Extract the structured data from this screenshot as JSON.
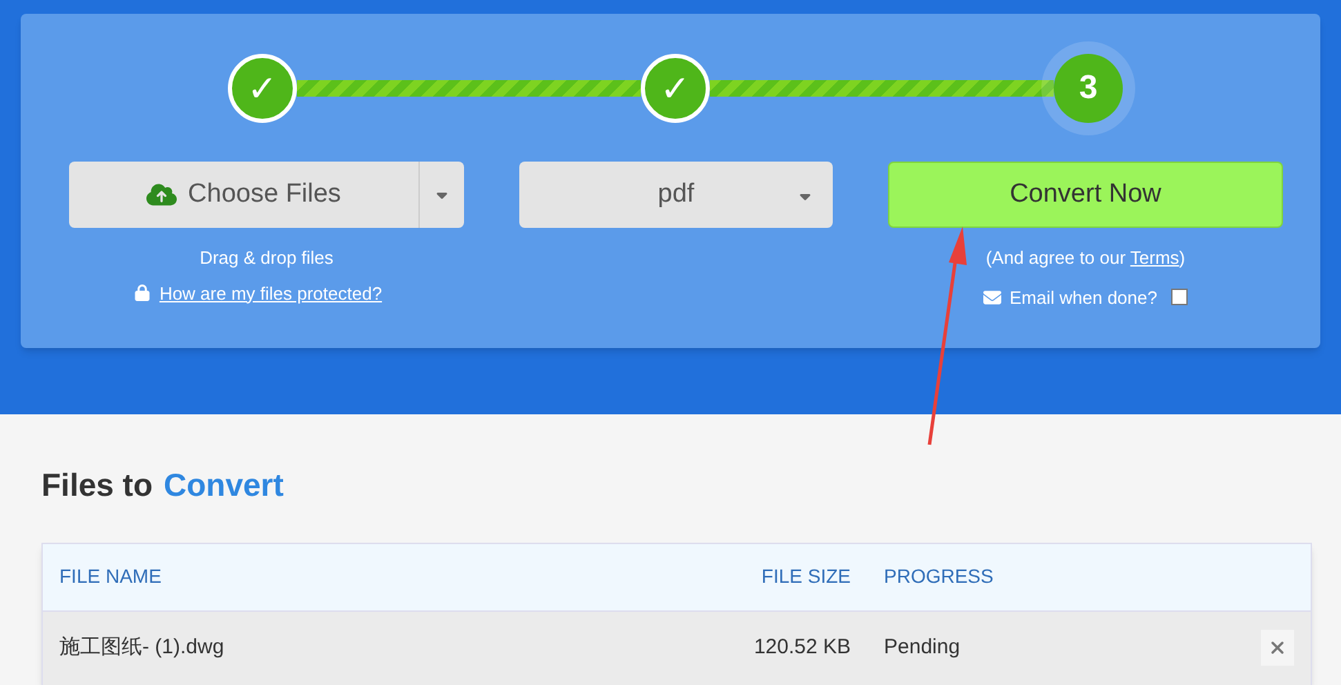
{
  "steps": [
    {
      "label": "✓",
      "kind": "done"
    },
    {
      "label": "✓",
      "kind": "done"
    },
    {
      "label": "3",
      "kind": "current"
    }
  ],
  "connectors": [
    {
      "level": 1
    },
    {
      "level": 1
    }
  ],
  "choose_files": {
    "label": "Choose Files",
    "hint": "Drag & drop files",
    "protect_link": "How are my files protected?"
  },
  "format_select": {
    "value": "pdf"
  },
  "convert": {
    "label": "Convert Now",
    "agree_lead": "(And agree to our ",
    "terms_link": "Terms",
    "agree_tail": ")",
    "email_label": "Email when done?",
    "email_checked": false
  },
  "files": {
    "title_lead": "Files to",
    "title_accent": "Convert",
    "columns": [
      "FILE NAME",
      "FILE SIZE",
      "PROGRESS"
    ],
    "rows": [
      {
        "name": "施工图纸- (1).dwg",
        "size": "120.52 KB",
        "progress": "Pending"
      }
    ]
  }
}
